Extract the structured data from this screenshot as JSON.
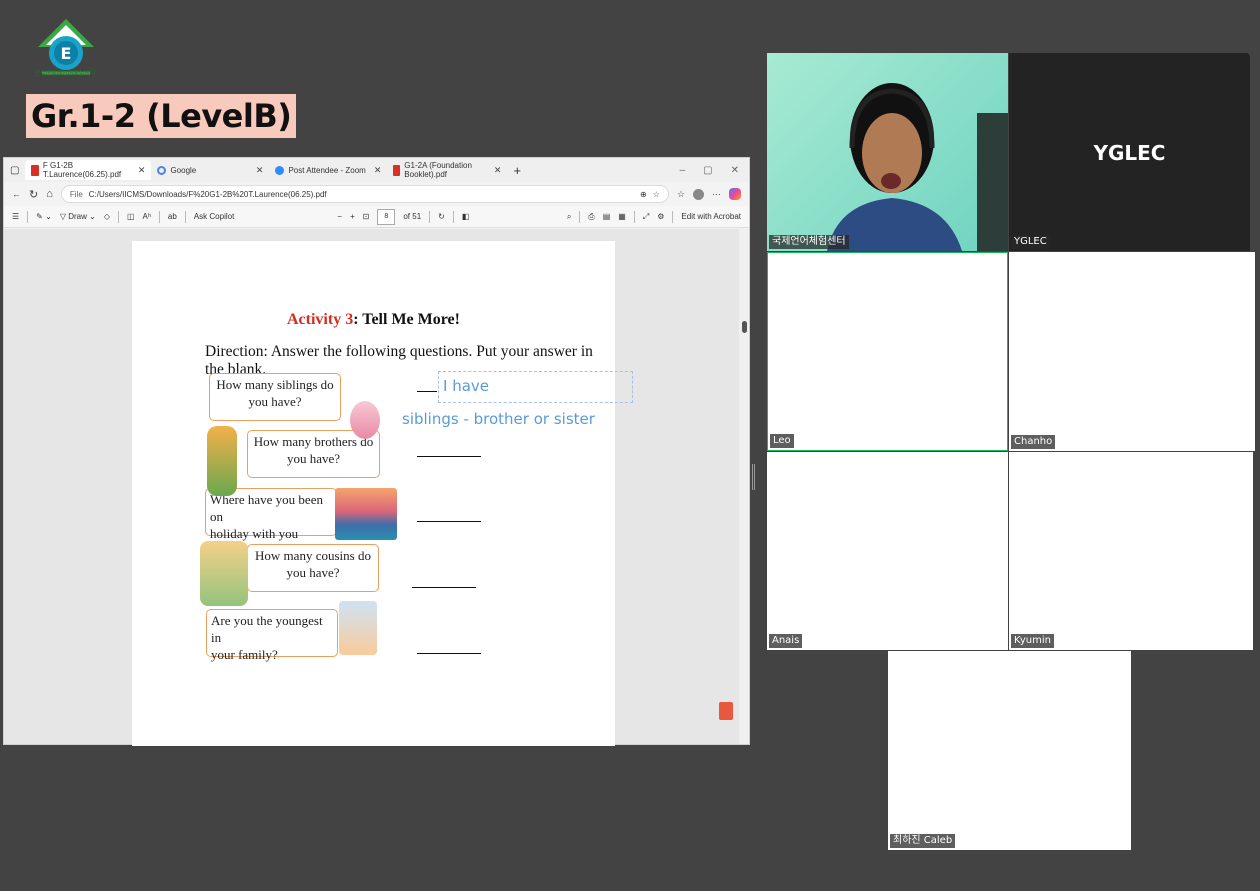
{
  "header": {
    "logo_caption": "인수군국제언어체험센터",
    "title": "Gr.1-2 (LevelB)"
  },
  "browser": {
    "tabs": [
      {
        "label": "F G1-2B T.Laurence(06.25).pdf",
        "icon": "pdf-icon"
      },
      {
        "label": "Google",
        "icon": "google-icon"
      },
      {
        "label": "Post Attendee - Zoom",
        "icon": "zoom-icon"
      },
      {
        "label": "G1-2A (Foundation Booklet).pdf",
        "icon": "pdf-icon"
      }
    ],
    "new_tab": "+",
    "address": {
      "chip": "File",
      "url": "C:/Users/IICMS/Downloads/F%20G1-2B%20T.Laurence(06.25).pdf"
    },
    "toolbar": {
      "draw_label": "Draw",
      "ask_copilot": "Ask Copilot",
      "zoom_minus": "−",
      "zoom_plus": "+",
      "page_current": "8",
      "page_total": "of 51",
      "edit_acrobat": "Edit with Acrobat"
    }
  },
  "document": {
    "activity_prefix": "Activity 3",
    "activity_title": ": Tell Me More!",
    "direction": "Direction: Answer the following questions. Put your answer in the blank.",
    "questions": [
      {
        "line1": "How many siblings do",
        "line2": "you have?"
      },
      {
        "line1": "How many brothers do",
        "line2": "you have?"
      },
      {
        "line1": "Where have you been on",
        "line2": "holiday with you family?"
      },
      {
        "line1": "How many cousins do",
        "line2": "you have?"
      },
      {
        "line1": "Are you the youngest in",
        "line2": "your family?"
      }
    ],
    "answer_line1": "I have",
    "answer_line2": "siblings - brother or sister"
  },
  "zoom": {
    "participants": [
      {
        "name": "국제언어체험센터",
        "video": true
      },
      {
        "name": "YGLEC",
        "display": "YGLEC"
      },
      {
        "name": "Leo"
      },
      {
        "name": "Chanho"
      },
      {
        "name": "Anais"
      },
      {
        "name": "Kyumin"
      },
      {
        "name": "최하진 Caleb"
      }
    ]
  }
}
